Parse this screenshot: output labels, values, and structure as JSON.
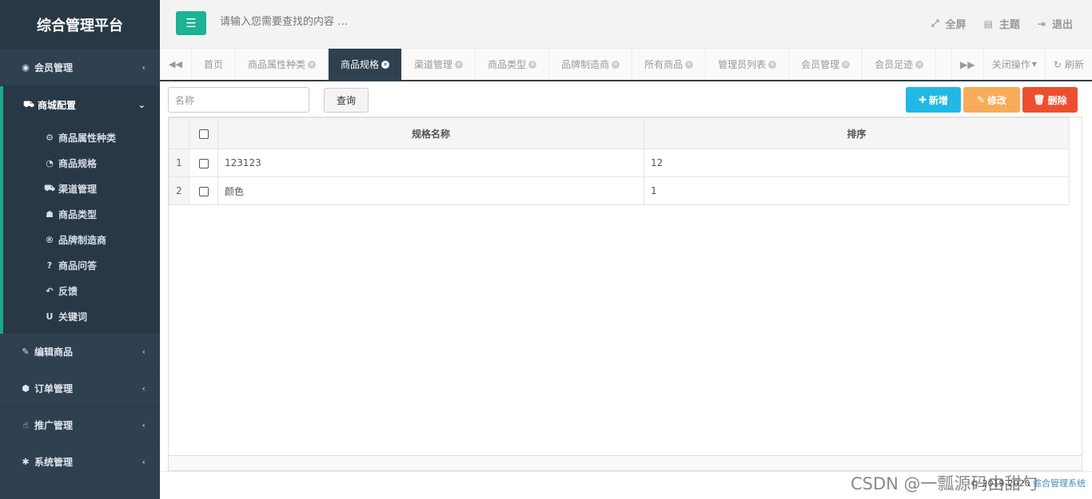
{
  "app": {
    "title": "综合管理平台"
  },
  "sidebar": {
    "member": {
      "label": "会员管理",
      "arrow": "‹"
    },
    "mall": {
      "label": "商城配置",
      "arrow": "⌄"
    },
    "mall_items": [
      {
        "label": "商品属性种类",
        "icon": "⚙"
      },
      {
        "label": "商品规格",
        "icon": "◔"
      },
      {
        "label": "渠道管理",
        "icon": "⛟"
      },
      {
        "label": "商品类型",
        "icon": "☗"
      },
      {
        "label": "品牌制造商",
        "icon": "®"
      },
      {
        "label": "商品问答",
        "icon": "?"
      },
      {
        "label": "反馈",
        "icon": "↶"
      },
      {
        "label": "关键词",
        "icon": "U"
      }
    ],
    "edit": {
      "label": "编辑商品",
      "arrow": "‹"
    },
    "orders": {
      "label": "订单管理",
      "arrow": "‹"
    },
    "promo": {
      "label": "推广管理",
      "arrow": "‹"
    },
    "system": {
      "label": "系统管理",
      "arrow": "‹"
    }
  },
  "topbar": {
    "search_placeholder": "请输入您需要查找的内容 …",
    "fullscreen": "全屏",
    "theme": "主题",
    "logout": "退出"
  },
  "tabs": {
    "items": [
      "首页",
      "商品属性种类",
      "商品规格",
      "渠道管理",
      "商品类型",
      "品牌制造商",
      "所有商品",
      "管理员列表",
      "会员管理",
      "会员足迹"
    ],
    "close_ops": "关闭操作",
    "refresh": "刷新"
  },
  "toolbar": {
    "name_placeholder": "名称",
    "query": "查询",
    "add": "新增",
    "edit": "修改",
    "delete": "删除"
  },
  "table": {
    "headers": [
      "规格名称",
      "排序"
    ],
    "rows": [
      {
        "num": "1",
        "name": "123123",
        "sort": "12"
      },
      {
        "num": "2",
        "name": "颜色",
        "sort": "1"
      }
    ]
  },
  "footer": {
    "copyright": "© 2019-2020 ",
    "system_link": "综合管理系统"
  },
  "watermark": "CSDN @一瓢源码由甜勺"
}
